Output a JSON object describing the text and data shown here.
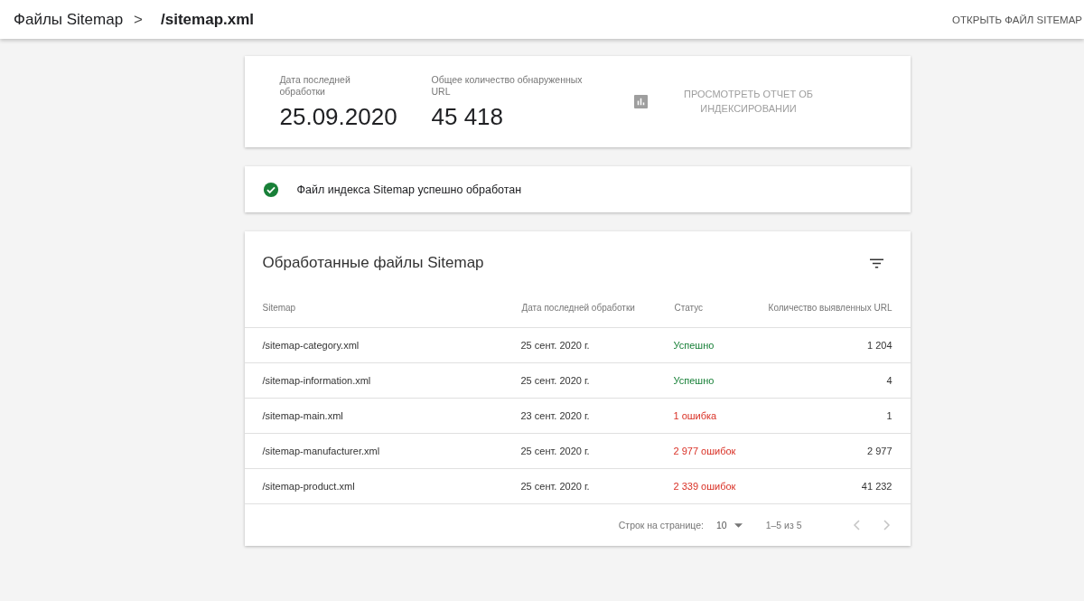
{
  "header": {
    "breadcrumb": [
      "Файлы Sitemap",
      "/sitemap.xml"
    ],
    "separator": ">",
    "action": "ОТКРЫТЬ ФАЙЛ SITEMAP"
  },
  "summary": {
    "stats": [
      {
        "label": "Дата последней обработки",
        "value": "25.09.2020"
      },
      {
        "label": "Общее количество обнаруженных URL",
        "value": "45 418"
      }
    ],
    "report_button": {
      "label": "ПРОСМОТРЕТЬ ОТЧЕТ ОБ ИНДЕКСИРОВАНИИ",
      "disabled": true
    }
  },
  "status_message": {
    "kind": "success",
    "text": "Файл индекса Sitemap успешно обработан"
  },
  "table": {
    "title": "Обработанные файлы Sitemap",
    "columns": [
      "Sitemap",
      "Дата последней обработки",
      "Статус",
      "Количество выявленных URL"
    ],
    "rows": [
      {
        "sitemap": "/sitemap-category.xml",
        "date": "25 сент. 2020 г.",
        "status": "Успешно",
        "kind": "success",
        "urls": "1 204"
      },
      {
        "sitemap": "/sitemap-information.xml",
        "date": "25 сент. 2020 г.",
        "status": "Успешно",
        "kind": "success",
        "urls": "4"
      },
      {
        "sitemap": "/sitemap-main.xml",
        "date": "23 сент. 2020 г.",
        "status": "1 ошибка",
        "kind": "error",
        "urls": "1"
      },
      {
        "sitemap": "/sitemap-manufacturer.xml",
        "date": "25 сент. 2020 г.",
        "status": "2 977 ошибок",
        "kind": "error",
        "urls": "2 977"
      },
      {
        "sitemap": "/sitemap-product.xml",
        "date": "25 сент. 2020 г.",
        "status": "2 339 ошибок",
        "kind": "error",
        "urls": "41 232"
      }
    ],
    "pagination": {
      "rows_label": "Строк на странице:",
      "rows_value": "10",
      "range": "1–5 из 5",
      "prev_disabled": true,
      "next_disabled": true
    }
  }
}
